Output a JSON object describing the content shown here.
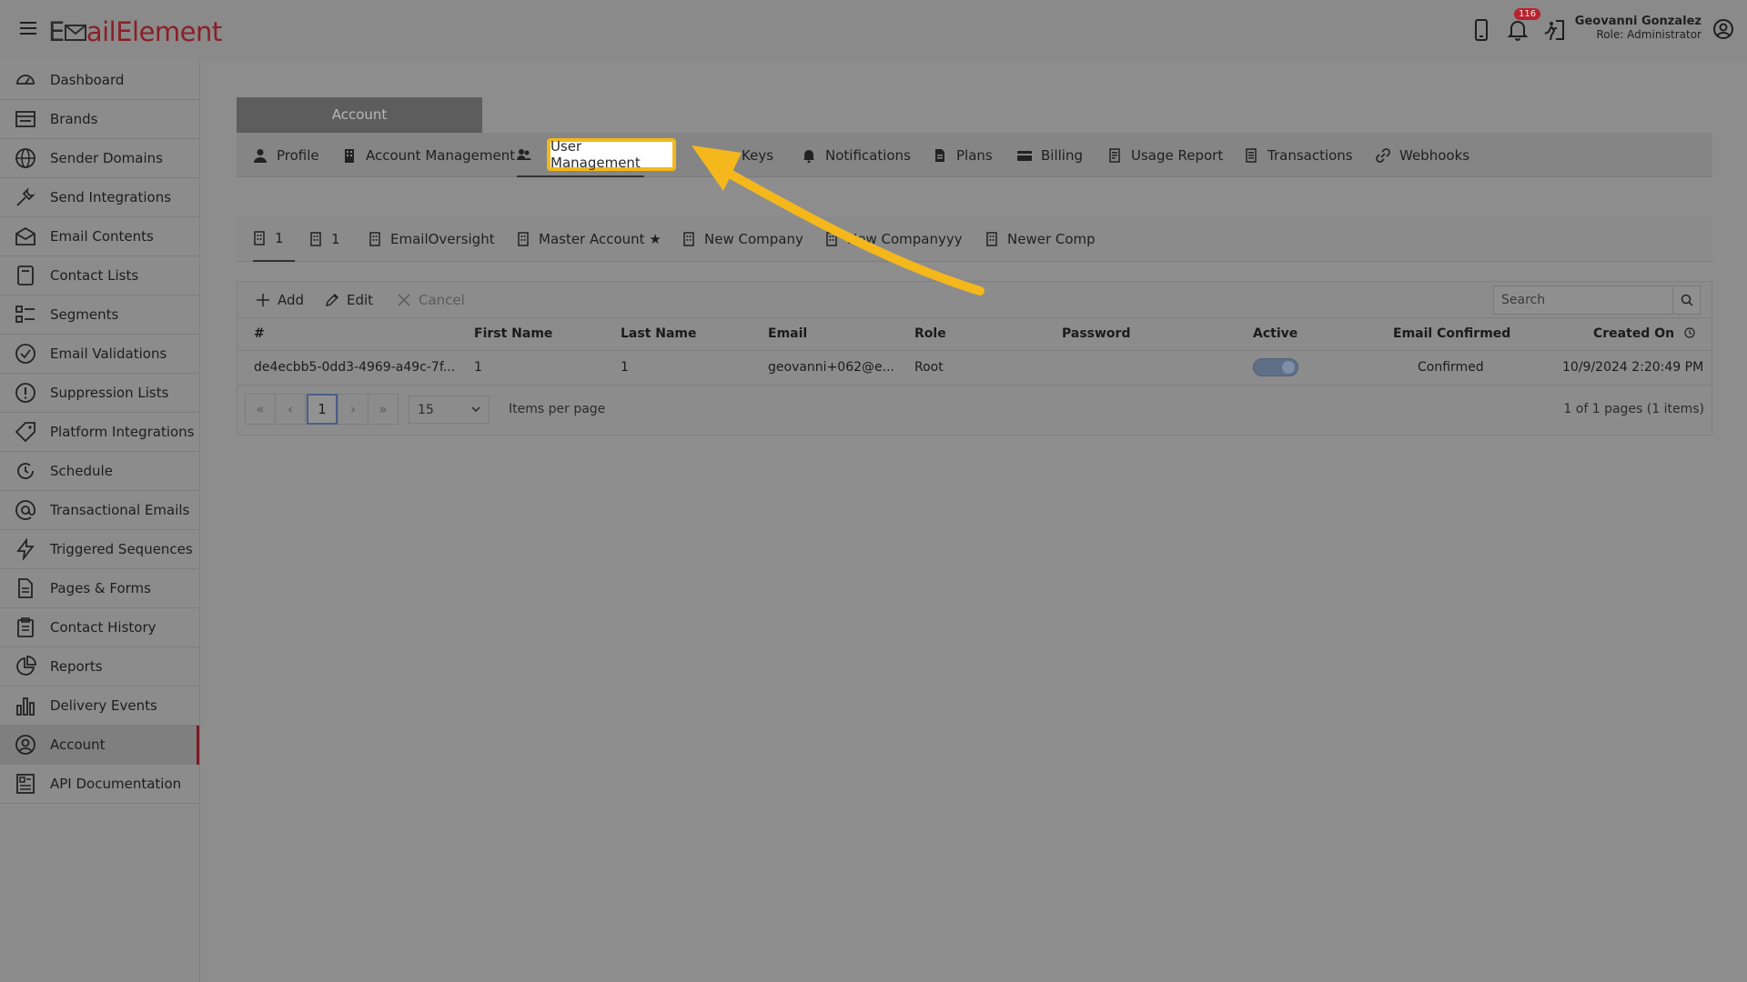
{
  "header": {
    "logo_prefix": "E",
    "logo_rest": "ailElement",
    "notification_count": "116",
    "user_name": "Geovanni Gonzalez",
    "user_role": "Role: Administrator"
  },
  "sidebar": {
    "items": [
      {
        "label": "Dashboard",
        "icon": "dashboard-icon"
      },
      {
        "label": "Brands",
        "icon": "brands-icon"
      },
      {
        "label": "Sender Domains",
        "icon": "globe-icon"
      },
      {
        "label": "Send Integrations",
        "icon": "wrench-icon"
      },
      {
        "label": "Email Contents",
        "icon": "envelope-icon"
      },
      {
        "label": "Contact Lists",
        "icon": "contact-book-icon"
      },
      {
        "label": "Segments",
        "icon": "segments-icon"
      },
      {
        "label": "Email Validations",
        "icon": "check-circle-icon"
      },
      {
        "label": "Suppression Lists",
        "icon": "exclamation-circle-icon"
      },
      {
        "label": "Platform Integrations",
        "icon": "tag-icon"
      },
      {
        "label": "Schedule",
        "icon": "clock-icon"
      },
      {
        "label": "Transactional Emails",
        "icon": "at-icon"
      },
      {
        "label": "Triggered Sequences",
        "icon": "lightning-icon"
      },
      {
        "label": "Pages & Forms",
        "icon": "page-icon"
      },
      {
        "label": "Contact History",
        "icon": "clipboard-icon"
      },
      {
        "label": "Reports",
        "icon": "pie-chart-icon"
      },
      {
        "label": "Delivery Events",
        "icon": "bar-chart-icon"
      },
      {
        "label": "Account",
        "icon": "user-circle-icon"
      },
      {
        "label": "API Documentation",
        "icon": "api-doc-icon"
      }
    ],
    "active_index": 17
  },
  "account_header": "Account",
  "tabs": {
    "profile": "Profile",
    "account_management": "Account Management",
    "user_management": "User Management",
    "keys": "Keys",
    "notifications": "Notifications",
    "plans": "Plans",
    "billing": "Billing",
    "usage_report": "Usage Report",
    "transactions": "Transactions",
    "webhooks": "Webhooks"
  },
  "companies": [
    "1",
    "1",
    "EmailOversight",
    "Master Account ★",
    "New Company",
    "New Companyyy",
    "Newer Comp"
  ],
  "toolbar": {
    "add": "Add",
    "edit": "Edit",
    "cancel": "Cancel",
    "search_placeholder": "Search"
  },
  "table": {
    "columns": [
      "#",
      "First Name",
      "Last Name",
      "Email",
      "Role",
      "Password",
      "Active",
      "Email Confirmed",
      "Created On"
    ],
    "rows": [
      {
        "id": "de4ecbb5-0dd3-4969-a49c-7f...",
        "first_name": "1",
        "last_name": "1",
        "email": "geovanni+062@e...",
        "role": "Root",
        "password": "",
        "active": true,
        "email_confirmed": "Confirmed",
        "created_on": "10/9/2024 2:20:49 PM"
      }
    ]
  },
  "pager": {
    "current_page": "1",
    "page_size": "15",
    "items_label": "Items per page",
    "info": "1 of 1 pages (1 items)"
  },
  "colors": {
    "highlight_border": "#f2b81c",
    "arrow": "#f4b81d",
    "brand": "#8a1f28"
  }
}
